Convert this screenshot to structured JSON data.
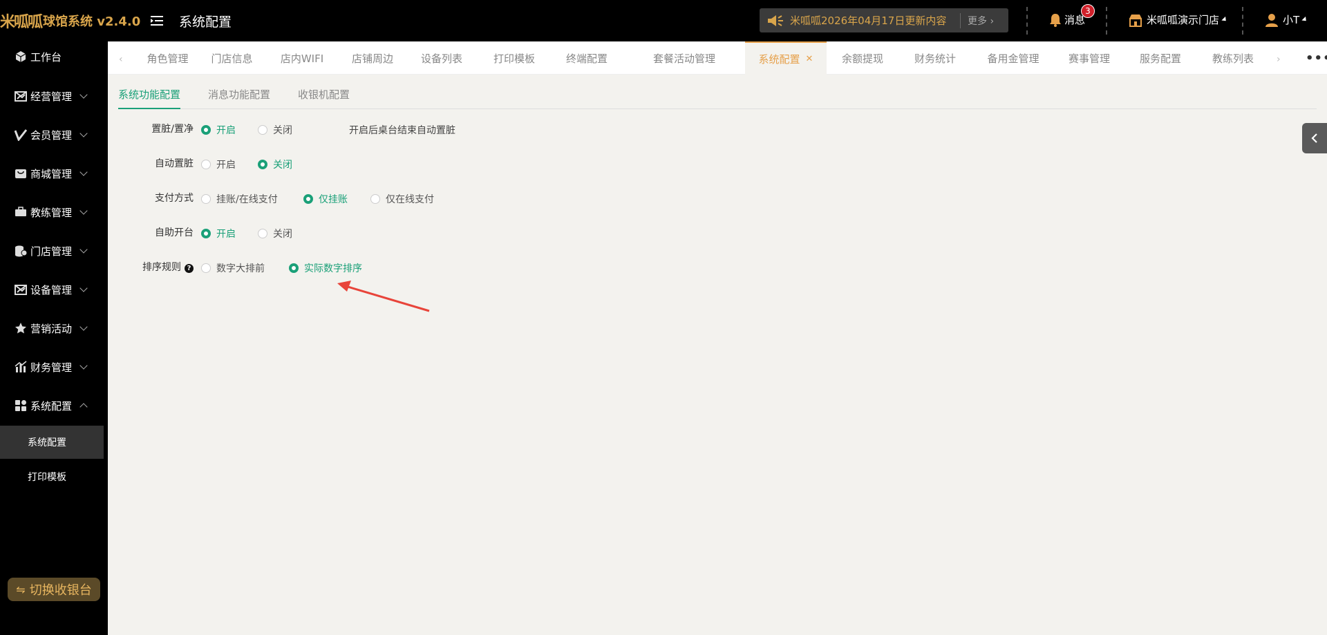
{
  "header": {
    "logo_mark": "米呱呱",
    "app_name": "球馆系统 v2.4.0",
    "page_title": "系统配置",
    "notice_text": "米呱呱2026年04月17日更新内容",
    "notice_more": "更多",
    "messages_label": "消息",
    "messages_count": "3",
    "store_name": "米呱呱演示门店",
    "user_name": "小T",
    "accent_color": "#d9a54b"
  },
  "sidebar": {
    "items": [
      {
        "label": "工作台",
        "icon": "cube-icon"
      },
      {
        "label": "经营管理",
        "icon": "chart-icon"
      },
      {
        "label": "会员管理",
        "icon": "check-icon"
      },
      {
        "label": "商城管理",
        "icon": "shop-icon"
      },
      {
        "label": "教练管理",
        "icon": "coach-icon"
      },
      {
        "label": "门店管理",
        "icon": "coins-icon"
      },
      {
        "label": "设备管理",
        "icon": "device-icon"
      },
      {
        "label": "营销活动",
        "icon": "star-icon"
      },
      {
        "label": "财务管理",
        "icon": "bar-chart-icon"
      },
      {
        "label": "系统配置",
        "icon": "grid-icon"
      }
    ],
    "sub_items": [
      {
        "label": "系统配置"
      },
      {
        "label": "打印模板"
      }
    ],
    "switch_label": "切换收银台"
  },
  "tabs": [
    {
      "label": "角色管理"
    },
    {
      "label": "门店信息"
    },
    {
      "label": "店内WIFI"
    },
    {
      "label": "店铺周边"
    },
    {
      "label": "设备列表"
    },
    {
      "label": "打印模板"
    },
    {
      "label": "终端配置"
    },
    {
      "label": "套餐活动管理"
    },
    {
      "label": "系统配置"
    },
    {
      "label": "余额提现"
    },
    {
      "label": "财务统计"
    },
    {
      "label": "备用金管理"
    },
    {
      "label": "赛事管理"
    },
    {
      "label": "服务配置"
    },
    {
      "label": "教练列表"
    }
  ],
  "subtabs": [
    {
      "label": "系统功能配置"
    },
    {
      "label": "消息功能配置"
    },
    {
      "label": "收银机配置"
    }
  ],
  "form": {
    "rows": [
      {
        "label": "置脏/置净",
        "options": [
          "开启",
          "关闭"
        ],
        "selected": 0,
        "hint": "开启后桌台结束自动置脏"
      },
      {
        "label": "自动置脏",
        "options": [
          "开启",
          "关闭"
        ],
        "selected": 1
      },
      {
        "label": "支付方式",
        "options": [
          "挂账/在线支付",
          "仅挂账",
          "仅在线支付"
        ],
        "selected": 1
      },
      {
        "label": "自助开台",
        "options": [
          "开启",
          "关闭"
        ],
        "selected": 0
      },
      {
        "label": "排序规则",
        "options": [
          "数字大排前",
          "实际数字排序"
        ],
        "selected": 1
      }
    ],
    "help_glyph": "?",
    "primary_color": "#1aa078"
  }
}
